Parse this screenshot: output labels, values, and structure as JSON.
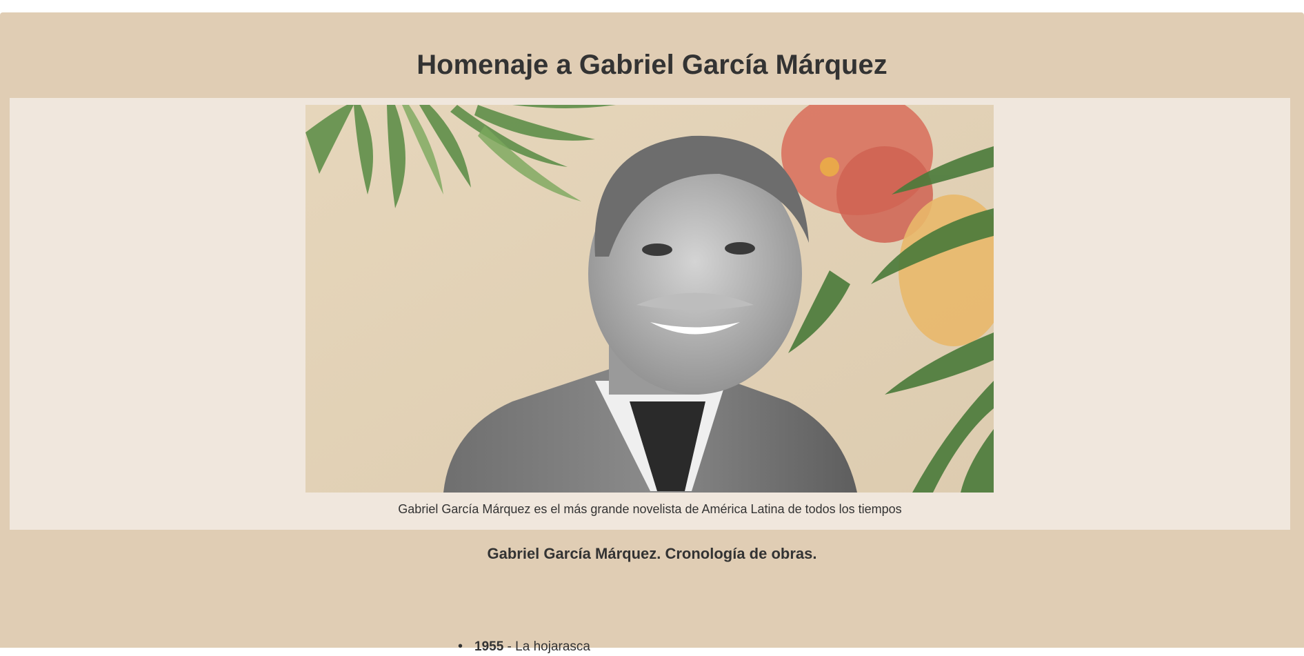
{
  "page": {
    "title": "Homenaje a Gabriel García Márquez"
  },
  "figure": {
    "image_alt": "Gabriel García Márquez",
    "caption": "Gabriel García Márquez es el más grande novelista de América Latina de todos los tiempos"
  },
  "tribute": {
    "heading": "Gabriel García Márquez. Cronología de obras.",
    "items": [
      {
        "bullet": "•",
        "year": "1955",
        "separator": " - ",
        "work": "La hojarasca"
      }
    ]
  },
  "colors": {
    "page_background": "#e0cdb4",
    "figure_background": "#f0e7dd",
    "text": "#333333"
  },
  "icons": {
    "list_bullet": "bullet-icon"
  }
}
